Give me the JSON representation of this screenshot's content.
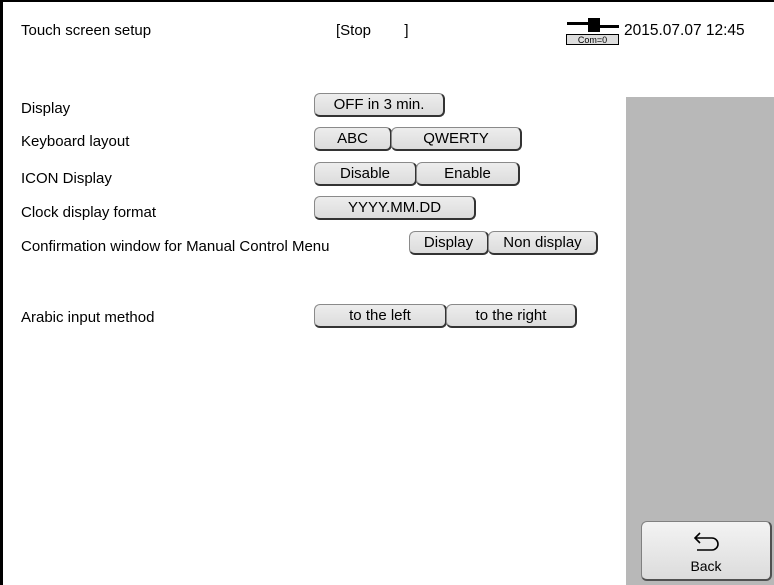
{
  "header": {
    "title": "Touch screen setup",
    "status": "[Stop        ]",
    "com_label": "Com=0",
    "datetime": "2015.07.07 12:45"
  },
  "settings": {
    "display": {
      "label": "Display",
      "value": "OFF in 3 min."
    },
    "keyboard": {
      "label": "Keyboard layout",
      "options": [
        "ABC",
        "QWERTY"
      ]
    },
    "icon_display": {
      "label": "ICON Display",
      "options": [
        "Disable",
        "Enable"
      ]
    },
    "clock_format": {
      "label": "Clock display format",
      "value": "YYYY.MM.DD"
    },
    "confirmation": {
      "label": "Confirmation window for Manual Control Menu",
      "options": [
        "Display",
        "Non display"
      ]
    },
    "arabic": {
      "label": "Arabic input method",
      "options": [
        "to the left",
        "to the right"
      ]
    }
  },
  "footer": {
    "back_label": "Back"
  },
  "colors": {
    "side_panel": "#b8b8b8",
    "background": "#ffffff"
  }
}
